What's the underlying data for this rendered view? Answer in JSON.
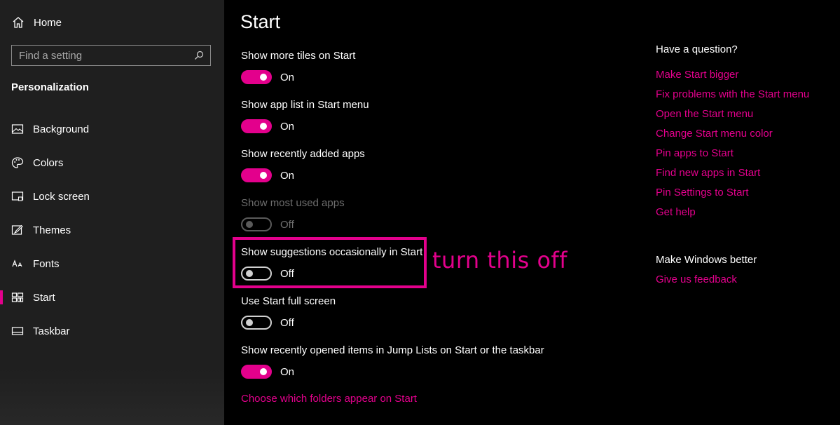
{
  "sidebar": {
    "home_label": "Home",
    "search_placeholder": "Find a setting",
    "section_title": "Personalization",
    "items": [
      {
        "label": "Background",
        "icon": "picture-icon"
      },
      {
        "label": "Colors",
        "icon": "palette-icon"
      },
      {
        "label": "Lock screen",
        "icon": "lock-screen-icon"
      },
      {
        "label": "Themes",
        "icon": "brush-icon"
      },
      {
        "label": "Fonts",
        "icon": "font-icon"
      },
      {
        "label": "Start",
        "icon": "start-icon",
        "selected": true
      },
      {
        "label": "Taskbar",
        "icon": "taskbar-icon"
      }
    ]
  },
  "main": {
    "title": "Start",
    "settings": [
      {
        "label": "Show more tiles on Start",
        "state": "On"
      },
      {
        "label": "Show app list in Start menu",
        "state": "On"
      },
      {
        "label": "Show recently added apps",
        "state": "On"
      },
      {
        "label": "Show most used apps",
        "state": "Off",
        "disabled": true
      },
      {
        "label": "Show suggestions occasionally in Start",
        "state": "Off"
      },
      {
        "label": "Use Start full screen",
        "state": "Off"
      },
      {
        "label": "Show recently opened items in Jump Lists on Start or the taskbar",
        "state": "On"
      }
    ],
    "folders_link": "Choose which folders appear on Start",
    "annotation": "turn this off"
  },
  "help": {
    "heading": "Have a question?",
    "links": [
      "Make Start bigger",
      "Fix problems with the Start menu",
      "Open the Start menu",
      "Change Start menu color",
      "Pin apps to Start",
      "Find new apps in Start",
      "Pin Settings to Start",
      "Get help"
    ],
    "feedback_heading": "Make Windows better",
    "feedback_link": "Give us feedback"
  },
  "colors": {
    "accent": "#e3008c",
    "sidebar_bg": "#1f1f1f",
    "main_bg": "#000000"
  }
}
